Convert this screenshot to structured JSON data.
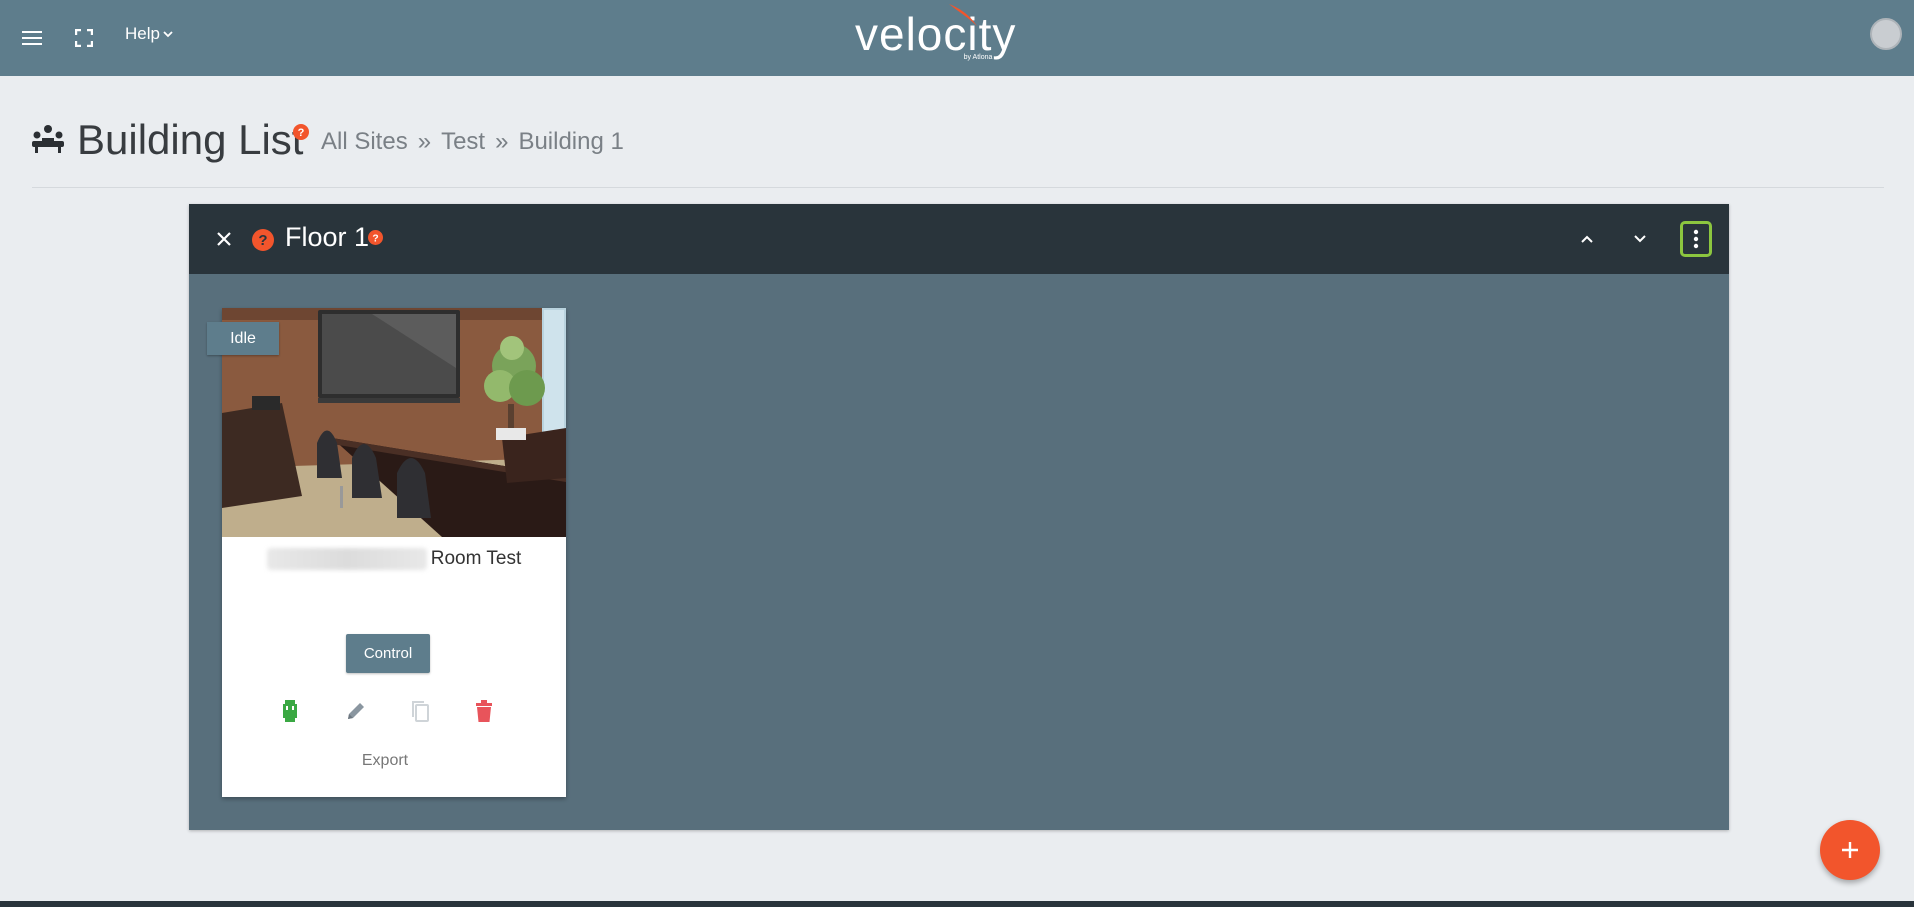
{
  "topbar": {
    "help_label": "Help",
    "logo_text": "velocity",
    "logo_sub": "by Atlona",
    "bg_color": "#5e7d8c"
  },
  "header": {
    "title": "Building List",
    "breadcrumbs": [
      "All Sites",
      "Test",
      "Building 1"
    ],
    "separator": "»"
  },
  "floor": {
    "title": "Floor 1",
    "header_color": "#29343b",
    "body_color": "#586f7c"
  },
  "room_card": {
    "status": "Idle",
    "name_suffix": "Room Test",
    "control_label": "Control",
    "export_label": "Export",
    "icons": [
      "device-icon",
      "edit-icon",
      "copy-icon",
      "delete-icon"
    ]
  },
  "colors": {
    "accent": "#f2552c",
    "highlight": "#8cc63f",
    "ok": "#3aa843",
    "danger": "#e8545b"
  }
}
